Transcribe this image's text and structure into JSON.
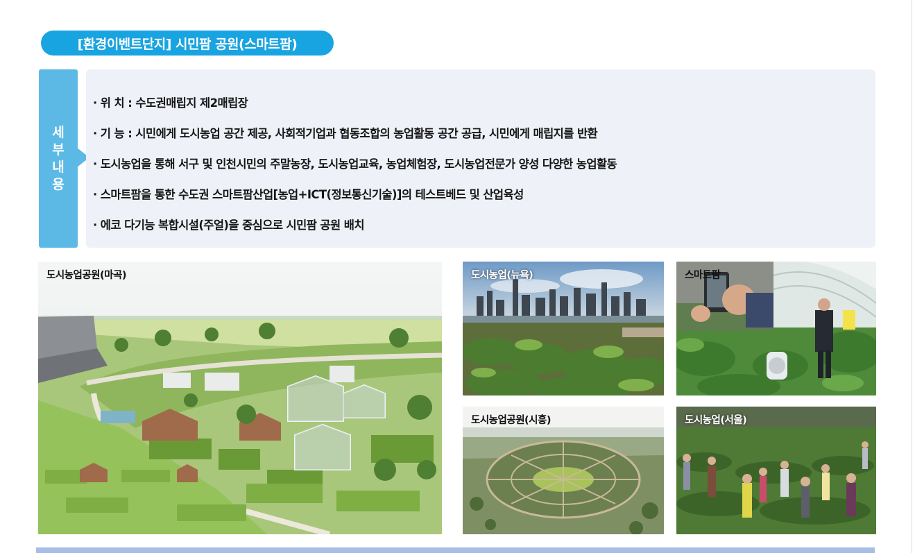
{
  "title": "[환경이벤트단지] 시민팜 공원(스마트팜)",
  "side_tab": {
    "chars": [
      "세",
      "부",
      "내",
      "용"
    ]
  },
  "details": [
    "· 위  치 : 수도권매립지 제2매립장",
    "· 기  능 : 시민에게 도시농업 공간 제공, 사회적기업과 협동조합의 농업활동 공간 공급, 시민에게 매립지를 반환",
    "· 도시농업을 통해 서구 및 인천시민의 주말농장, 도시농업교육, 농업체험장, 도시농업전문가 양성 다양한 농업활동",
    "· 스마트팜을 통한 수도권 스마트팜산업[농업+ICT(정보통신기술)]의 테스트베드 및 산업육성",
    "· 에코 다기능 복합시설(주얼)을 중심으로 시민팜 공원 배치"
  ],
  "photos": {
    "magok": "도시농업공원(마곡)",
    "newyork": "도시농업(뉴욕)",
    "smartfarm": "스마트팜",
    "siheung": "도시농업공원(시흥)",
    "seoul": "도시농업(서울)"
  },
  "colors": {
    "accent": "#18a4e0",
    "tab": "#5cb9e6",
    "panel": "#eef1f8",
    "bottom_bar": "#a8bde4"
  }
}
